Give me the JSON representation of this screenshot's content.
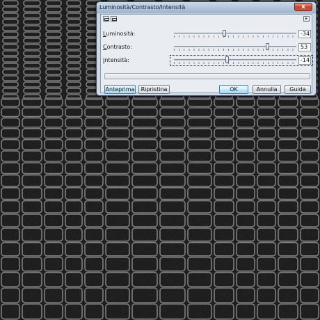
{
  "background": {
    "description_colors": {
      "base": "#0a0a0a",
      "ridge": "#9a9a9a"
    }
  },
  "dialog": {
    "title": "Luminosità/Contrasto/Intensità",
    "close_glyph": "x",
    "arrow_glyph": "▸",
    "sliders": [
      {
        "label_underlined": "L",
        "label_rest": "uminosità:",
        "value": "-34",
        "fraction": 0.41
      },
      {
        "label_underlined": "C",
        "label_rest": "ontrasto:",
        "value": "53",
        "fraction": 0.76
      },
      {
        "label_underlined": "I",
        "label_rest": "ntensità:",
        "value": "-14",
        "fraction": 0.43
      }
    ],
    "buttons": {
      "preview": "Anteprima",
      "reset": "Ripristina",
      "ok": "OK",
      "cancel": "Annulla",
      "help": "Guida"
    }
  },
  "colors": {
    "title_bar": "#a9bfd5",
    "close": "#c2432c",
    "default_button": "#bee6fd"
  }
}
